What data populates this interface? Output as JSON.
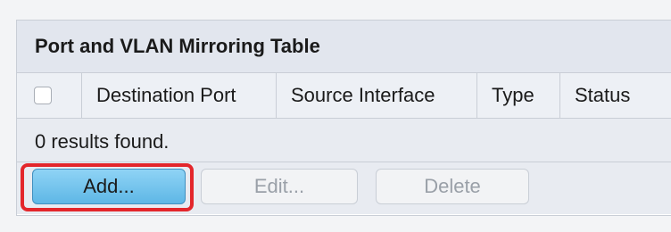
{
  "table": {
    "title": "Port and VLAN Mirroring Table",
    "columns": [
      "Destination Port",
      "Source Interface",
      "Type",
      "Status"
    ],
    "results_text": "0 results found.",
    "select_all_checked": false
  },
  "buttons": {
    "add_label": "Add...",
    "edit_label": "Edit...",
    "delete_label": "Delete"
  },
  "colors": {
    "highlight": "#e3262b",
    "add_button": "#5eb7e6"
  }
}
